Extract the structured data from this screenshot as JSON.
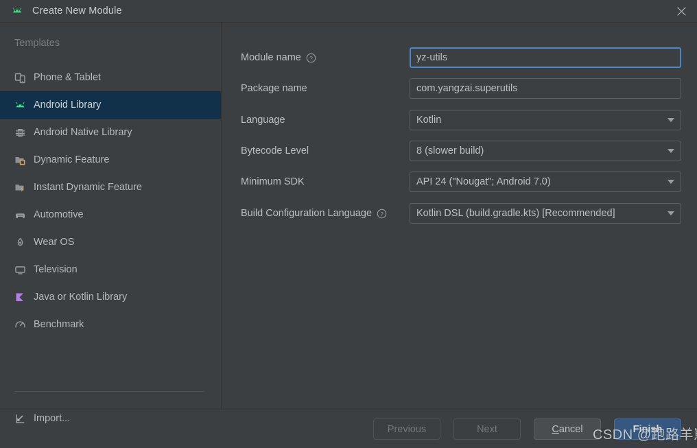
{
  "window": {
    "title": "Create New Module",
    "app_icon": "android-head-icon",
    "close_icon": "close-icon"
  },
  "sidebar": {
    "header": "Templates",
    "selected_index": 1,
    "items": [
      {
        "label": "Phone & Tablet",
        "icon": "phone-tablet-icon"
      },
      {
        "label": "Android Library",
        "icon": "android-head-icon"
      },
      {
        "label": "Android Native Library",
        "icon": "native-chip-icon"
      },
      {
        "label": "Dynamic Feature",
        "icon": "dynamic-feature-folder-icon"
      },
      {
        "label": "Instant Dynamic Feature",
        "icon": "instant-dynamic-feature-folder-icon"
      },
      {
        "label": "Automotive",
        "icon": "car-icon"
      },
      {
        "label": "Wear OS",
        "icon": "watch-icon"
      },
      {
        "label": "Television",
        "icon": "television-icon"
      },
      {
        "label": "Java or Kotlin Library",
        "icon": "kotlin-library-icon"
      },
      {
        "label": "Benchmark",
        "icon": "benchmark-gauge-icon"
      }
    ],
    "import": {
      "label": "Import...",
      "icon": "import-arrow-icon"
    }
  },
  "form": {
    "fields": [
      {
        "label": "Module name",
        "value": "yz-utils",
        "type": "text",
        "focused": true,
        "help": true,
        "help_icon": "help-circle-icon"
      },
      {
        "label": "Package name",
        "value": "com.yangzai.superutils",
        "type": "text",
        "focused": false,
        "help": false
      },
      {
        "label": "Language",
        "value": "Kotlin",
        "type": "select",
        "focused": false,
        "help": false
      },
      {
        "label": "Bytecode Level",
        "value": "8 (slower build)",
        "type": "select",
        "focused": false,
        "help": false
      },
      {
        "label": "Minimum SDK",
        "value": "API 24 (\"Nougat\"; Android 7.0)",
        "type": "select",
        "focused": false,
        "help": false
      },
      {
        "label": "Build Configuration Language",
        "value": "Kotlin DSL (build.gradle.kts) [Recommended]",
        "type": "select",
        "focused": false,
        "help": true,
        "help_icon": "help-circle-icon"
      }
    ]
  },
  "footer": {
    "previous": "Previous",
    "next": "Next",
    "cancel_prefix": "",
    "cancel_accel": "C",
    "cancel_rest": "ancel",
    "cancel_label": "Cancel",
    "finish": "Finish"
  },
  "watermark": "CSDN @跑路羊崽",
  "colors": {
    "window_bg": "#3c3f41",
    "selection_bg": "#113049",
    "focus_border": "#4a88c7",
    "primary_button": "#365880",
    "android_green": "#3ddc84",
    "accent_orange": "#e8a33d",
    "kotlin_purple": "#b17fdd"
  }
}
